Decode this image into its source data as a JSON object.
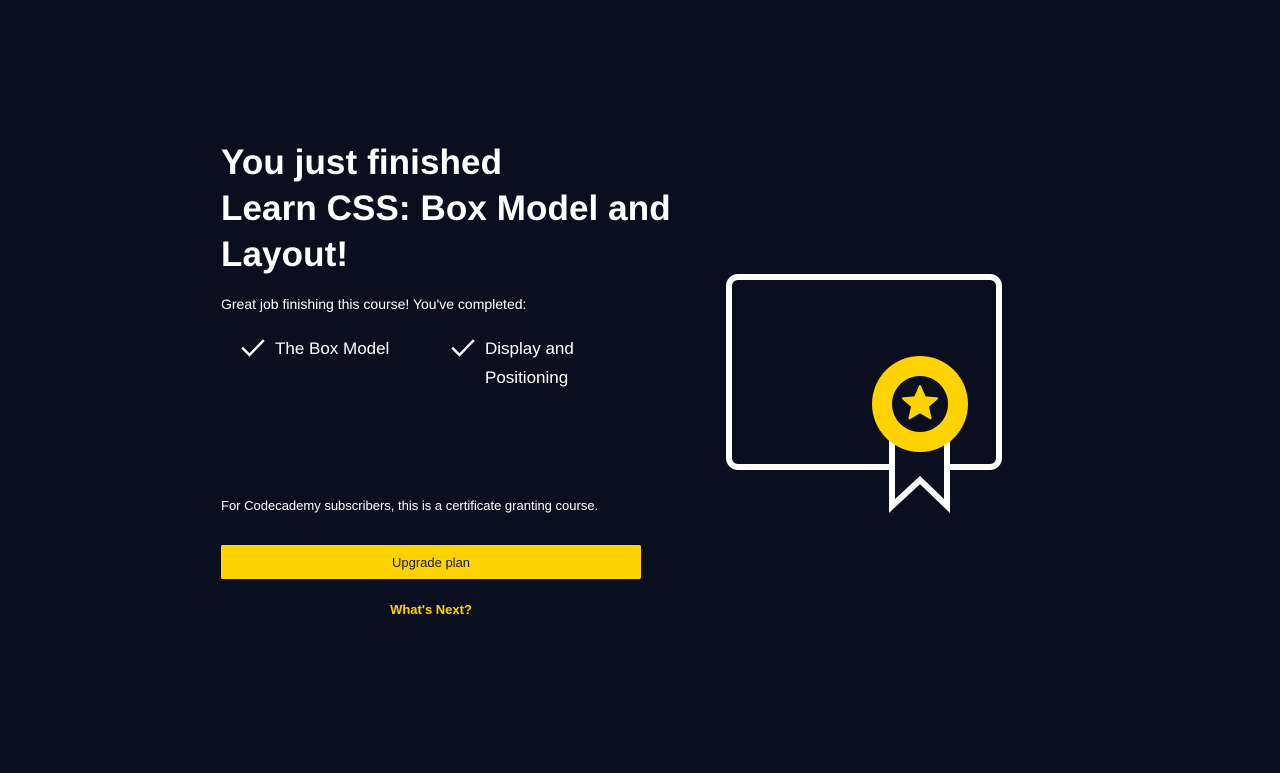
{
  "headline": {
    "line1": "You just finished",
    "line2": "Learn CSS: Box Model and",
    "line3": "Layout!"
  },
  "intro_text": "Great job finishing this course! You've completed:",
  "completed_items": [
    {
      "label": "The Box Model",
      "icon": "checkmark-icon"
    },
    {
      "label": "Display and Positioning",
      "icon": "checkmark-icon"
    }
  ],
  "subscriber_note": "For Codecademy subscribers, this is a certificate granting course.",
  "upgrade_button_label": "Upgrade plan",
  "whats_next_label": "What's Next?",
  "illustration": {
    "icon": "certificate-icon",
    "badge_icon": "star-badge-icon"
  },
  "colors": {
    "background": "#0b0e1f",
    "accent": "#ffd300",
    "text": "#ffffff",
    "button_text": "#10162f"
  }
}
